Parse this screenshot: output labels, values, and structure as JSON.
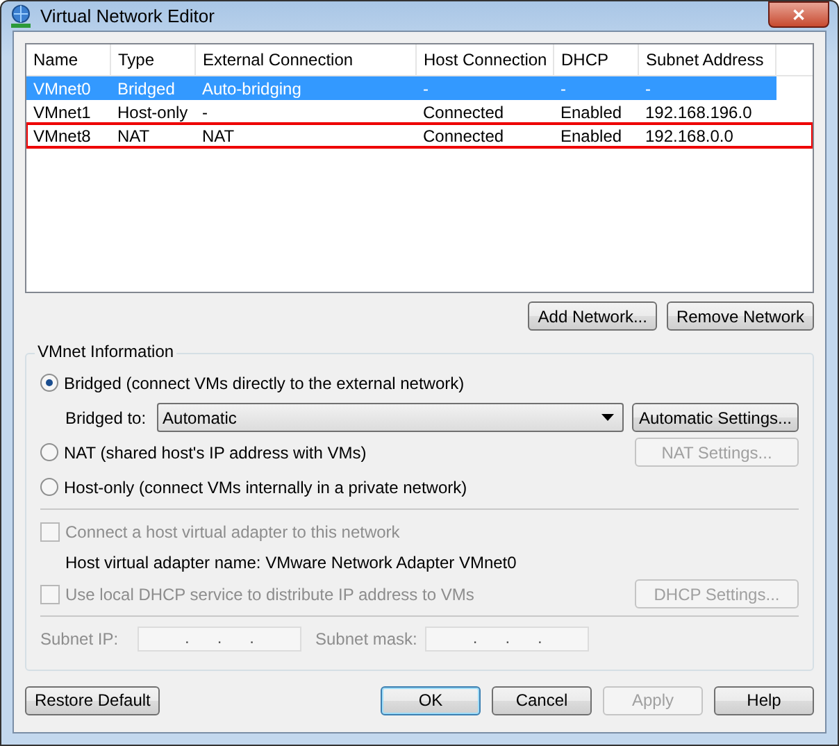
{
  "window": {
    "title": "Virtual Network Editor",
    "close": "✕"
  },
  "table": {
    "columns": [
      "Name",
      "Type",
      "External Connection",
      "Host Connection",
      "DHCP",
      "Subnet Address"
    ],
    "rows": [
      {
        "cells": [
          "VMnet0",
          "Bridged",
          "Auto-bridging",
          "-",
          "-",
          "-"
        ],
        "selected": true,
        "highlighted": false
      },
      {
        "cells": [
          "VMnet1",
          "Host-only",
          "-",
          "Connected",
          "Enabled",
          "192.168.196.0"
        ],
        "selected": false,
        "highlighted": false
      },
      {
        "cells": [
          "VMnet8",
          "NAT",
          "NAT",
          "Connected",
          "Enabled",
          "192.168.0.0"
        ],
        "selected": false,
        "highlighted": true
      }
    ]
  },
  "list_buttons": [
    {
      "label": "Add Network...",
      "disabled": false
    },
    {
      "label": "Remove Network",
      "disabled": false
    }
  ],
  "group": {
    "title": "VMnet Information",
    "bridged": {
      "label": "Bridged (connect VMs directly to the external network)",
      "selected": true
    },
    "bridged_to": {
      "label": "Bridged to:",
      "value": "Automatic",
      "button": "Automatic Settings...",
      "disabled": false
    },
    "nat": {
      "label": "NAT (shared host's IP address with VMs)",
      "selected": false,
      "button": "NAT Settings...",
      "disabled": true
    },
    "host_only": {
      "label": "Host-only (connect VMs internally in a private network)",
      "selected": false
    },
    "connect_adapter": {
      "label": "Connect a host virtual adapter to this network",
      "checked": false,
      "disabled": true
    },
    "adapter_name": "Host virtual adapter name: VMware Network Adapter VMnet0",
    "dhcp": {
      "label": "Use local DHCP service to distribute IP address to VMs",
      "checked": false,
      "disabled": true,
      "button": "DHCP Settings..."
    },
    "subnet_ip": {
      "label": "Subnet IP:",
      "separators": [
        ".",
        ".",
        "."
      ],
      "disabled": true
    },
    "subnet_mask": {
      "label": "Subnet mask:",
      "separators": [
        ".",
        ".",
        "."
      ],
      "disabled": true
    }
  },
  "footer": {
    "restore": {
      "label": "Restore Default",
      "disabled": false
    },
    "buttons": [
      {
        "label": "OK",
        "disabled": false,
        "default": true
      },
      {
        "label": "Cancel",
        "disabled": false,
        "default": false
      },
      {
        "label": "Apply",
        "disabled": true,
        "default": false
      },
      {
        "label": "Help",
        "disabled": false,
        "default": false
      }
    ]
  }
}
